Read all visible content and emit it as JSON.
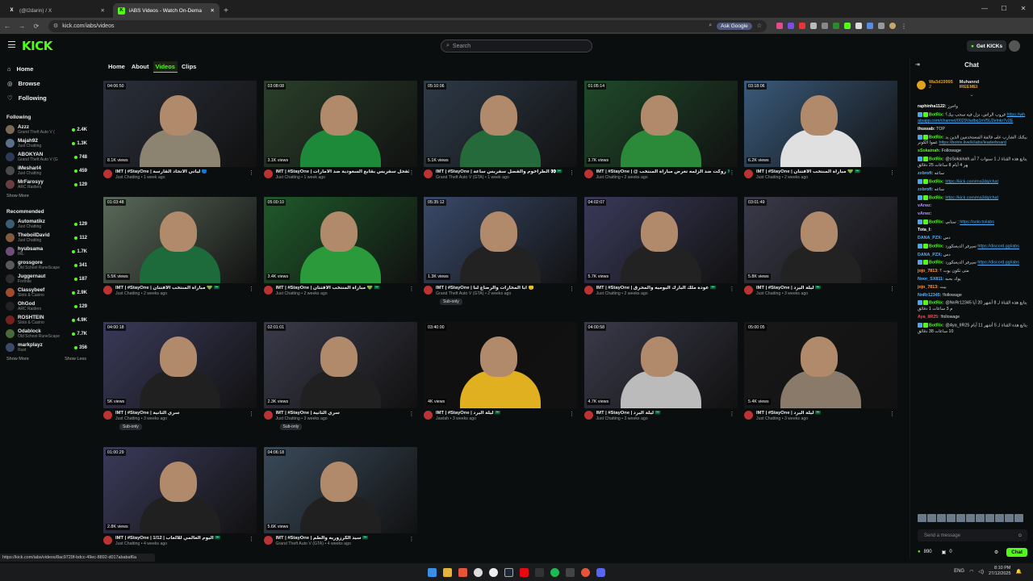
{
  "browser": {
    "tabs": [
      {
        "label": "(@l2darin) / X",
        "icon": "x-logo-icon",
        "active": false
      },
      {
        "label": "iABS Videos - Watch On-Dema",
        "icon": "kick-favicon-icon",
        "active": true
      }
    ],
    "url": "kick.com/iabs/videos",
    "ask_google": "Ask Google"
  },
  "header": {
    "logo": "KICK",
    "search_placeholder": "Search",
    "get_kicks": "Get KICKs"
  },
  "sidebar": {
    "nav": [
      {
        "label": "Home",
        "icon": "home-icon"
      },
      {
        "label": "Browse",
        "icon": "compass-icon"
      },
      {
        "label": "Following",
        "icon": "heart-icon"
      }
    ],
    "following_title": "Following",
    "following": [
      {
        "name": "Azzz",
        "category": "Grand Theft Auto V (",
        "viewers": "2.4K",
        "color": "#7b6a4f"
      },
      {
        "name": "Majah92",
        "category": "Just Chatting",
        "viewers": "1.3K",
        "color": "#5a6f8a"
      },
      {
        "name": "ABOKYAN",
        "category": "Grand Theft Auto V (G",
        "viewers": "748",
        "color": "#2e3a5a"
      },
      {
        "name": "iMesharl4",
        "category": "Just Chatting",
        "viewers": "459",
        "color": "#4a4a4a"
      },
      {
        "name": "MrFarosyy",
        "category": "ARC Raiders",
        "viewers": "129",
        "color": "#6a3e3e"
      }
    ],
    "show_more": "Show More",
    "recommended_title": "Recommended",
    "recommended": [
      {
        "name": "Automatikz",
        "category": "Just Chatting",
        "viewers": "129",
        "color": "#3b5e73"
      },
      {
        "name": "TheboiIDavid",
        "category": "Just Chatting",
        "viewers": "112",
        "color": "#845a3c"
      },
      {
        "name": "hyubsama",
        "category": "IRL",
        "viewers": "1.7K",
        "color": "#6f4f7a"
      },
      {
        "name": "grossgore",
        "category": "Old School RuneScape",
        "viewers": "341",
        "color": "#5a5a5a"
      },
      {
        "name": "Juggernaut",
        "category": "Fortnite",
        "viewers": "187",
        "color": "#2c2c2c"
      },
      {
        "name": "Classybeef",
        "category": "Slots & Casino",
        "viewers": "2.9K",
        "color": "#a34a2c"
      },
      {
        "name": "OhGod",
        "category": "ARC Raiders",
        "viewers": "129",
        "color": "#222"
      },
      {
        "name": "ROSHTEIN",
        "category": "Slots & Casino",
        "viewers": "4.9K",
        "color": "#7a1f1f"
      },
      {
        "name": "Odablock",
        "category": "Old School RuneScape",
        "viewers": "7.7K",
        "color": "#4a6a3a"
      },
      {
        "name": "markplayz",
        "category": "Rust",
        "viewers": "356",
        "color": "#3a4a6a"
      }
    ],
    "show_more_2": "Show More",
    "show_less": "Show Less"
  },
  "channel_tabs": [
    "Home",
    "About",
    "Videos",
    "Clips"
  ],
  "active_tab": "Videos",
  "videos": [
    {
      "duration": "04:06:50",
      "views": "8.1K views",
      "title": "IMT | #StayOne | لياتي الاتحاد القارسة 🔵",
      "category": "Just Chatting",
      "age": "1 week ago",
      "sub_only": false,
      "bg": "#2a2f3a",
      "accent": "#8c8470"
    },
    {
      "duration": "03:08:08",
      "views": "3.1K views",
      "title": "IMT | #StayOne | الفحل سفريس بقابع السعودية ضد الامارات 🇸🇦",
      "category": "Just Chatting",
      "age": "1 week ago",
      "sub_only": false,
      "bg": "#2a3f2a",
      "accent": "#1d8a3a"
    },
    {
      "duration": "05:10:06",
      "views": "5.1K views",
      "title": "IMT | #StayOne | الطراخوم والفضل سفريس ساعة 👀🇸🇦",
      "category": "Grand Theft Auto V (GTA)",
      "age": "1 week ago",
      "sub_only": false,
      "bg": "#2e3a48",
      "accent": "#246a3a"
    },
    {
      "duration": "01:05:14",
      "views": "3.7K views",
      "title": "IMT | #StayOne | @ روكت ضد الزلمه تعرض مباراة المنتخب 🇸🇦",
      "category": "Just Chatting",
      "age": "2 weeks ago",
      "sub_only": false,
      "bg": "#1f4a2a",
      "accent": "#2a8a3a"
    },
    {
      "duration": "03:18:06",
      "views": "6.2K views",
      "title": "IMT | #StayOne | مباراة المنتخب الافتتان 💚 🇸🇦",
      "category": "Just Chatting",
      "age": "2 weeks ago",
      "sub_only": false,
      "bg": "#3a5a7a",
      "accent": "#e0e0e0"
    },
    {
      "duration": "01:03:48",
      "views": "5.5K views",
      "title": "IMT | #StayOne | مباراة المنتخب الافتتان 💚 🇸🇦",
      "category": "Just Chatting",
      "age": "2 weeks ago",
      "sub_only": false,
      "bg": "#5a6a5a",
      "accent": "#1d6a3a"
    },
    {
      "duration": "05:00:10",
      "views": "3.4K views",
      "title": "IMT | #StayOne | مباراة المنتخب الافتتان 💚 🇸🇦",
      "category": "Just Chatting",
      "age": "2 weeks ago",
      "sub_only": false,
      "bg": "#1f5a2a",
      "accent": "#2a9a3a"
    },
    {
      "duration": "05:35:12",
      "views": "1.3K views",
      "title": "IMT | #StayOne | ابا المخارات والرضاع لنا 🙂",
      "category": "Grand Theft Auto V (GTA)",
      "age": "2 weeks ago",
      "sub_only": true,
      "bg": "#3a4a6a",
      "accent": "#222"
    },
    {
      "duration": "04:02:07",
      "views": "5.7K views",
      "title": "IMT | #StayOne | عودة ملك البارك البوميه والمحرق 🇸🇦",
      "category": "Just Chatting",
      "age": "2 weeks ago",
      "sub_only": false,
      "bg": "#3a3a5a",
      "accent": "#222"
    },
    {
      "duration": "03:01:49",
      "views": "5.8K views",
      "title": "IMT | #StayOne | ليلة اليرد 🇸🇦",
      "category": "Just Chatting",
      "age": "3 weeks ago",
      "sub_only": false,
      "bg": "#3a3a4a",
      "accent": "#222"
    },
    {
      "duration": "04:00:18",
      "views": "5K views",
      "title": "IMT | #StayOne | سري الثانية",
      "category": "Just Chatting",
      "age": "3 weeks ago",
      "sub_only": true,
      "bg": "#3a3a5a",
      "accent": "#202020"
    },
    {
      "duration": "02:01:01",
      "views": "2.3K views",
      "title": "IMT | #StayOne | سري الثانية",
      "category": "Just Chatting",
      "age": "3 weeks ago",
      "sub_only": true,
      "bg": "#3a3a4a",
      "accent": "#202020"
    },
    {
      "duration": "03:40:00",
      "views": "4K views",
      "title": "IMT | #StayOne | ليلة اليرد 🇸🇦",
      "category": "Jawlah",
      "age": "3 weeks ago",
      "sub_only": false,
      "bg": "#101010",
      "accent": "#e0b020"
    },
    {
      "duration": "04:00:58",
      "views": "4.7K views",
      "title": "IMT | #StayOne | ليلة اليرد 🇸🇦",
      "category": "Just Chatting",
      "age": "3 weeks ago",
      "sub_only": false,
      "bg": "#3a3a4a",
      "accent": "#bbb"
    },
    {
      "duration": "05:00:05",
      "views": "5.4K views",
      "title": "IMT | #StayOne | ليلة اليرد 🇸🇦",
      "category": "Just Chatting",
      "age": "3 weeks ago",
      "sub_only": false,
      "bg": "#181818",
      "accent": "#8a7a6a"
    },
    {
      "duration": "01:00:29",
      "views": "2.8K views",
      "title": "IMT | #StayOne | 1/12 | اليوم العالمي للالعاب 🇸🇦",
      "category": "Just Chatting",
      "age": "4 weeks ago",
      "sub_only": false,
      "bg": "#3a3a5a",
      "accent": "#202020"
    },
    {
      "duration": "04:06:18",
      "views": "5.6K views",
      "title": "IMT | #StayOne | سيد الكرزوريه والطم 🇸🇦",
      "category": "Grand Theft Auto V (GTA)",
      "age": "4 weeks ago",
      "sub_only": false,
      "bg": "#3a4a5a",
      "accent": "#202020"
    }
  ],
  "sub_only_label": "Sub-only",
  "chat": {
    "title": "Chat",
    "pinned": {
      "user1": "Wa3d19995",
      "count1": "2",
      "user2": "Muhannd",
      "user3": "IREEMEI"
    },
    "messages": [
      {
        "user": "raphinha1122:",
        "text": "واحرز",
        "color": "#ffffff",
        "link": ""
      },
      {
        "user": "BotRix:",
        "text": "قروب الراس، نزل فيه سحب بيك؟",
        "color": "#53fc18",
        "link": "https://whatsapp.com/channel/0029Vadbq1nV5U2elnkr7v2E"
      },
      {
        "user": "ihussab:",
        "text": "TOP",
        "color": "#ffffff",
        "link": ""
      },
      {
        "user": "BotRix:",
        "text": "بيكنك الشارب على قائمة المستخدمين الذين يدعموا الكونر",
        "color": "#53fc18",
        "link": "https://botrix.live/k/iabs/leaderboard"
      },
      {
        "user": "sSokainah:",
        "text": "Followage",
        "color": "#53fc18",
        "link": ""
      },
      {
        "user": "BotRix:",
        "text": "@sSokainah يتابع هذه القناة لـ 1 سنوات 7 أشهر 4 أيام 8 ساعات 25 دقائق",
        "color": "#53fc18",
        "link": ""
      },
      {
        "user": "zxbroft:",
        "text": "ساعه",
        "color": "#4db3ff",
        "link": ""
      },
      {
        "user": "BotRix:",
        "text": "",
        "color": "#53fc18",
        "link": "https://kick.com/ma3dq/chat"
      },
      {
        "user": "zxbroft:",
        "text": "ساعه",
        "color": "#4db3ff",
        "link": ""
      },
      {
        "user": "BotRix:",
        "text": "",
        "color": "#53fc18",
        "link": "https://kick.com/ma3dq/chat"
      },
      {
        "user": "vArwz:",
        "text": "",
        "color": "#b98fff",
        "link": ""
      },
      {
        "user": "vArwz:",
        "text": "",
        "color": "#b98fff",
        "link": ""
      },
      {
        "user": "BotRix:",
        "text": "سنابي :",
        "color": "#53fc18",
        "link": "https://solo.to/iabs"
      },
      {
        "user": "Tota_I:",
        "text": "",
        "color": "#ffffff",
        "link": ""
      },
      {
        "user": "DANA_PZX:",
        "text": "دس",
        "color": "#4db3ff",
        "link": ""
      },
      {
        "user": "BotRix:",
        "text": "سيرفر الديسكورد",
        "color": "#53fc18",
        "link": "https://discord.gg/iabs"
      },
      {
        "user": "DANA_PZX:",
        "text": "دس",
        "color": "#4db3ff",
        "link": ""
      },
      {
        "user": "BotRix:",
        "text": "سيرفر الديسكورد",
        "color": "#53fc18",
        "link": "https://discord.gg/iabs"
      },
      {
        "user": "jojo_7813:",
        "text": "متى تكون يوت ؟",
        "color": "#ff9a3a",
        "link": ""
      },
      {
        "user": "Noor_SX811:",
        "text": "يوك بحبه",
        "color": "#4db3ff",
        "link": ""
      },
      {
        "user": "jojo_7813:",
        "text": "بيت",
        "color": "#ff9a3a",
        "link": ""
      },
      {
        "user": "NnRr12345:",
        "text": "!followage",
        "color": "#4db3ff",
        "link": ""
      },
      {
        "user": "BotRix:",
        "text": "@NnRr12345 يتابع هذه القناة لـ 8 أشهر 20 أيام 3 ساعات 1 دقائق",
        "color": "#53fc18",
        "link": ""
      },
      {
        "user": "Aya_IIR25:",
        "text": "!followage",
        "color": "#ff4a4a",
        "link": ""
      },
      {
        "user": "BotRix:",
        "text": "@Aya_IIR25 يتابع هذه القناة لـ 5 أشهر 11 أيام 10 ساعات 38 دقائق",
        "color": "#53fc18",
        "link": ""
      }
    ],
    "input_placeholder": "Send a message",
    "kicks_balance": "890",
    "points": "0",
    "chat_button": "Chat"
  },
  "status_url": "https://kick.com/iabs/videos/8ac9729f-bdcc-49ec-8892-d017ababaf6a",
  "taskbar": {
    "lang": "ENG",
    "time": "8:10 PM",
    "date": "27/12/2025"
  }
}
